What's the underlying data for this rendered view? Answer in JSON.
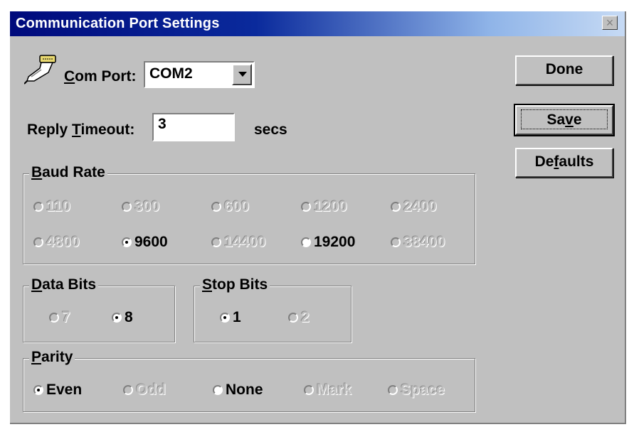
{
  "window": {
    "title": "Communication Port Settings",
    "close_label": "×"
  },
  "com_port": {
    "label_u": "C",
    "label_rest": "om Port:",
    "value": "COM2"
  },
  "timeout": {
    "label_pre": "Reply ",
    "label_u": "T",
    "label_rest": "imeout:",
    "value": "3",
    "unit": "secs"
  },
  "buttons": {
    "done": "Done",
    "save_pre": "Sa",
    "save_u": "v",
    "save_post": "e",
    "defaults_pre": "De",
    "defaults_u": "f",
    "defaults_post": "aults"
  },
  "baud_rate": {
    "legend_u": "B",
    "legend_rest": "aud Rate",
    "options": [
      "110",
      "300",
      "600",
      "1200",
      "2400",
      "4800",
      "9600",
      "14400",
      "19200",
      "38400"
    ],
    "selected": "9600"
  },
  "data_bits": {
    "legend_u": "D",
    "legend_rest": "ata Bits",
    "options": [
      "7",
      "8"
    ],
    "selected": "8"
  },
  "stop_bits": {
    "legend_u": "S",
    "legend_rest": "top Bits",
    "options": [
      "1",
      "2"
    ],
    "selected": "1"
  },
  "parity": {
    "legend_u": "P",
    "legend_rest": "arity",
    "options": [
      "Even",
      "Odd",
      "None",
      "Mark",
      "Space"
    ],
    "selected": "Even"
  },
  "icons": {
    "port": "serial-port-icon",
    "close": "close-icon",
    "dropdown": "chevron-down-icon"
  }
}
